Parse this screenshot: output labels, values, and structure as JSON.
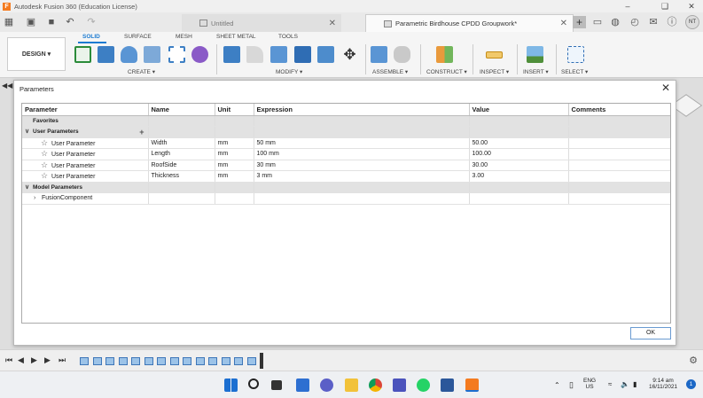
{
  "app": {
    "window_title": "Autodesk Fusion 360 (Education License)",
    "logo_letter": "F"
  },
  "tabs": {
    "inactive_label": "Untitled",
    "active_label": "Parametric Birdhouse CPDD Groupwork*",
    "user_initials": "NT"
  },
  "toolbar": {
    "workspace": "DESIGN ▾",
    "tabs": [
      "SOLID",
      "SURFACE",
      "MESH",
      "SHEET METAL",
      "TOOLS"
    ],
    "groups": [
      "CREATE ▾",
      "MODIFY ▾",
      "ASSEMBLE ▾",
      "CONSTRUCT ▾",
      "INSPECT ▾",
      "INSERT ▾",
      "SELECT ▾"
    ]
  },
  "dialog": {
    "title": "Parameters",
    "columns": [
      "Parameter",
      "Name",
      "Unit",
      "Expression",
      "Value",
      "Comments"
    ],
    "sections": {
      "favorites": "Favorites",
      "user_parameters": "User Parameters",
      "model_parameters": "Model Parameters"
    },
    "user_rows": [
      {
        "parameter": "User Parameter",
        "name": "Width",
        "unit": "mm",
        "expression": "50 mm",
        "value": "50.00",
        "comments": ""
      },
      {
        "parameter": "User Parameter",
        "name": "Length",
        "unit": "mm",
        "expression": "100 mm",
        "value": "100.00",
        "comments": ""
      },
      {
        "parameter": "User Parameter",
        "name": "RoofSide",
        "unit": "mm",
        "expression": "30 mm",
        "value": "30.00",
        "comments": ""
      },
      {
        "parameter": "User Parameter",
        "name": "Thickness",
        "unit": "mm",
        "expression": "3 mm",
        "value": "3.00",
        "comments": ""
      }
    ],
    "model_component": "FusionComponent",
    "ok_label": "OK"
  },
  "taskbar": {
    "language": "ENG",
    "region": "US",
    "time": "9:14 am",
    "date": "16/11/2021",
    "notification_count": "1"
  },
  "colors": {
    "accent": "#1c7bd1",
    "fusion_orange": "#f47b20"
  }
}
